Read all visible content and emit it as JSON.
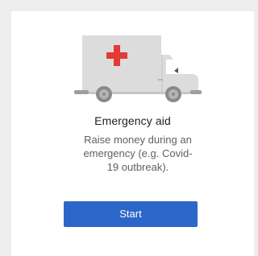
{
  "card": {
    "illustration_icon": "ambulance-icon",
    "title": "Emergency aid",
    "description": "Raise money during an emergency (e.g. Covid-19 outbreak).",
    "button_label": "Start"
  },
  "colors": {
    "background": "#eeeeee",
    "card": "#ffffff",
    "button": "#2b67c9",
    "van_body": "#dcdcdc",
    "cross": "#e53935"
  }
}
